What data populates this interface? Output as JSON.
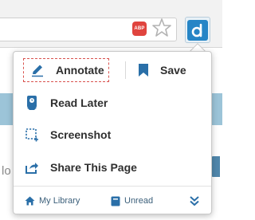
{
  "browser": {
    "adblock_text": "ABP",
    "icons": [
      "adblock-icon",
      "bookmark-star-icon",
      "diigo-extension-icon"
    ],
    "background_partial_text": "lo"
  },
  "popup": {
    "menu": {
      "annotate_label": "Annotate",
      "save_label": "Save",
      "read_later_label": "Read Later",
      "screenshot_label": "Screenshot",
      "share_label": "Share This Page"
    },
    "footer": {
      "my_library_label": "My Library",
      "unread_label": "Unread"
    }
  },
  "colors": {
    "accent": "#2685c6",
    "annotate_border": "#d9534f"
  }
}
